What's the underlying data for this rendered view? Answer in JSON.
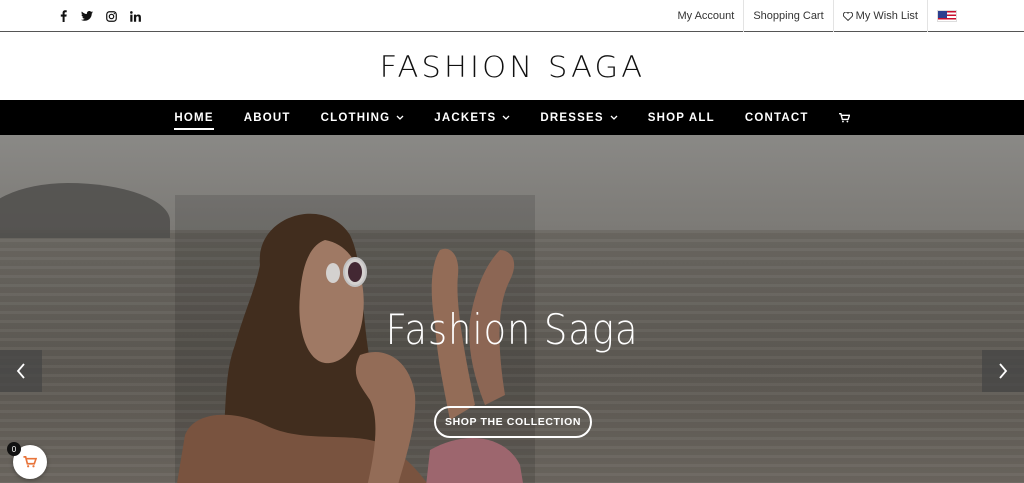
{
  "topbar": {
    "social": [
      "facebook-icon",
      "twitter-icon",
      "instagram-icon",
      "linkedin-icon"
    ],
    "links": {
      "my_account": "My Account",
      "shopping_cart": "Shopping Cart",
      "wish_list": "My Wish List"
    },
    "language_flag": "us-flag"
  },
  "logo": {
    "text": "FASHION SAGA"
  },
  "nav": {
    "items": [
      {
        "label": "HOME",
        "active": true
      },
      {
        "label": "ABOUT"
      },
      {
        "label": "CLOTHING",
        "dropdown": true
      },
      {
        "label": "JACKETS",
        "dropdown": true
      },
      {
        "label": "DRESSES",
        "dropdown": true
      },
      {
        "label": "SHOP ALL"
      },
      {
        "label": "CONTACT"
      }
    ],
    "cart_icon": "cart-icon"
  },
  "hero": {
    "title": "Fashion Saga",
    "cta": "SHOP THE COLLECTION",
    "prev_icon": "chevron-left-icon",
    "next_icon": "chevron-right-icon"
  },
  "cart_widget": {
    "count": "0",
    "accent": "#e8743b"
  }
}
